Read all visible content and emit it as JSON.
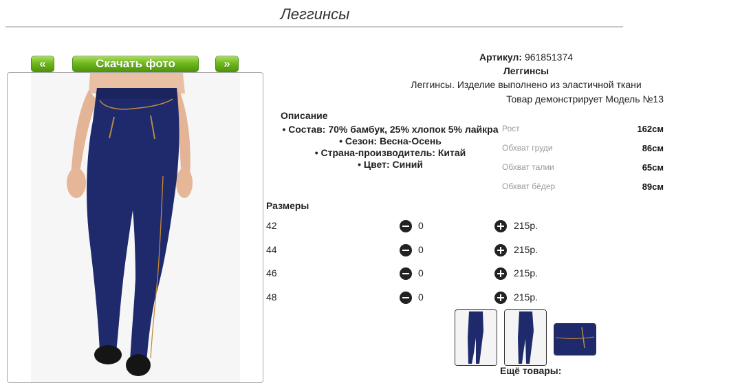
{
  "header": {
    "title": "Леггинсы"
  },
  "gallery": {
    "prev_label": "«",
    "download_label": "Скачать фото",
    "next_label": "»"
  },
  "product": {
    "sku_label": "Артикул:",
    "sku_value": "961851374",
    "name": "Леггинсы",
    "short_description": "Леггинсы. Изделие выполнено из эластичной ткани",
    "model_note": "Товар демонстрирует Модель №13"
  },
  "description": {
    "heading": "Описание",
    "items": [
      "Состав: 70% бамбук, 25% хлопок 5% лайкра",
      "Сезон: Весна-Осень",
      "Страна-производитель: Китай",
      "Цвет: Синий"
    ]
  },
  "measurements": [
    {
      "label": "Рост",
      "value": "162см"
    },
    {
      "label": "Обхват груди",
      "value": "86см"
    },
    {
      "label": "Обхват талии",
      "value": "65см"
    },
    {
      "label": "Обхват бёдер",
      "value": "89см"
    }
  ],
  "sizes": {
    "heading": "Размеры",
    "rows": [
      {
        "size": "42",
        "qty": "0",
        "price": "215р."
      },
      {
        "size": "44",
        "qty": "0",
        "price": "215р."
      },
      {
        "size": "46",
        "qty": "0",
        "price": "215р."
      },
      {
        "size": "48",
        "qty": "0",
        "price": "215р."
      }
    ]
  },
  "more_products_label": "Ещё товары:",
  "colors": {
    "fabric": "#1e2a6b",
    "button_green": "#6cb519"
  }
}
